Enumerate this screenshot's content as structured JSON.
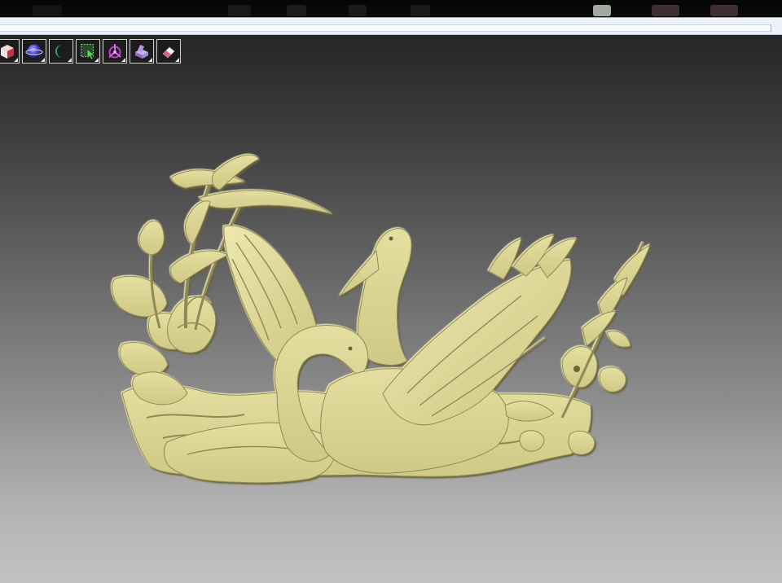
{
  "viewport": {
    "background_top": "#262626",
    "background_bottom": "#c2c2c2",
    "relief_color": "#d9d397",
    "relief_shadow": "#8f8a55",
    "relief_highlight": "#f1ecba"
  },
  "toolbar": {
    "buttons": [
      {
        "icon": "shaded-cube-icon"
      },
      {
        "icon": "sphere-icon"
      },
      {
        "icon": "crescent-moon-icon"
      },
      {
        "icon": "selection-arrow-icon"
      },
      {
        "icon": "transform-gizmo-icon"
      },
      {
        "icon": "relief-block-icon"
      },
      {
        "icon": "eraser-icon"
      }
    ]
  },
  "model": {
    "subject": "swan-relief-icon"
  }
}
